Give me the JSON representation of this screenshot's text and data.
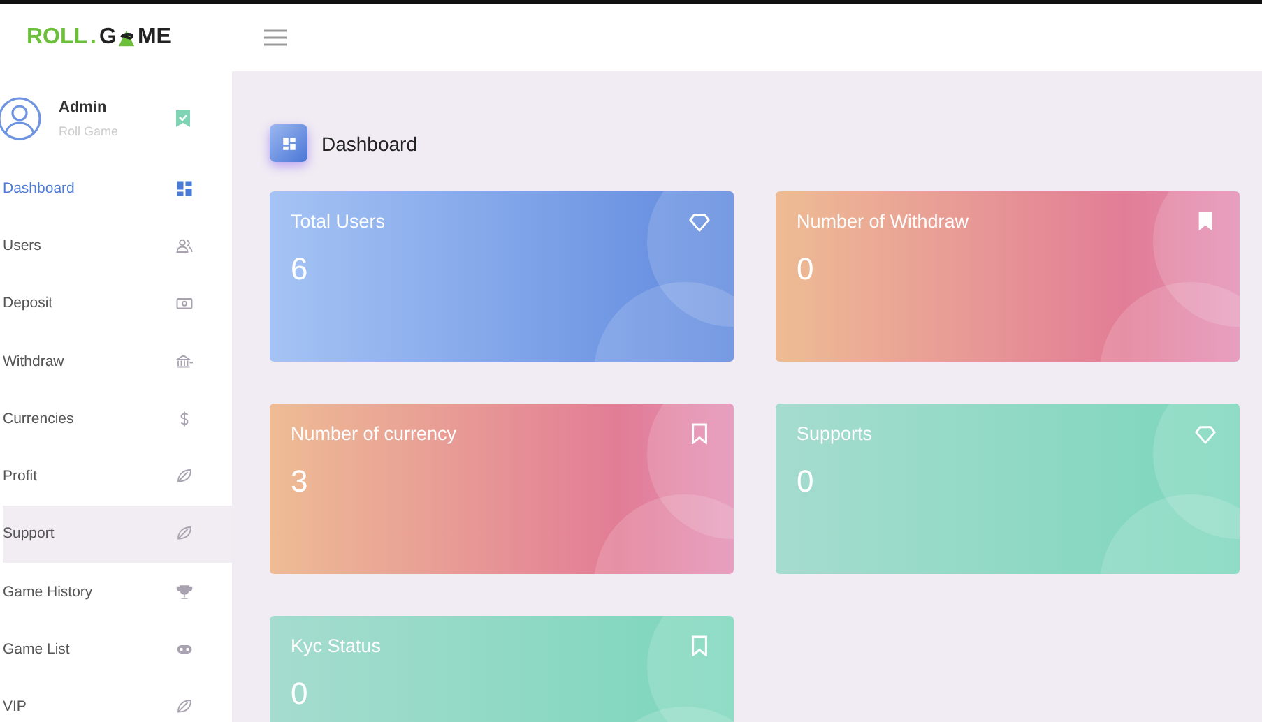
{
  "logo": {
    "part_1": "ROLL",
    "part_2": ".",
    "part_3": "G",
    "part_4": "ME"
  },
  "user": {
    "name": "Admin",
    "subtitle": "Roll Game"
  },
  "sidebar": {
    "items": [
      {
        "label": "Dashboard",
        "selected": true,
        "hovered": false
      },
      {
        "label": "Users",
        "selected": false,
        "hovered": false
      },
      {
        "label": "Deposit",
        "selected": false,
        "hovered": false
      },
      {
        "label": "Withdraw",
        "selected": false,
        "hovered": false
      },
      {
        "label": "Currencies",
        "selected": false,
        "hovered": false
      },
      {
        "label": "Profit",
        "selected": false,
        "hovered": false
      },
      {
        "label": "Support",
        "selected": false,
        "hovered": true
      },
      {
        "label": "Game History",
        "selected": false,
        "hovered": false
      },
      {
        "label": "Game List",
        "selected": false,
        "hovered": false
      },
      {
        "label": "VIP",
        "selected": false,
        "hovered": false
      }
    ]
  },
  "page_title": "Dashboard",
  "cards": [
    {
      "label": "Total Users",
      "value": "6",
      "kind": "blue"
    },
    {
      "label": "Number of Withdraw",
      "value": "0",
      "kind": "peach"
    },
    {
      "label": "Number of currency",
      "value": "3",
      "kind": "peach"
    },
    {
      "label": "Supports",
      "value": "0",
      "kind": "mint"
    },
    {
      "label": "Kyc Status",
      "value": "0",
      "kind": "mint"
    }
  ]
}
